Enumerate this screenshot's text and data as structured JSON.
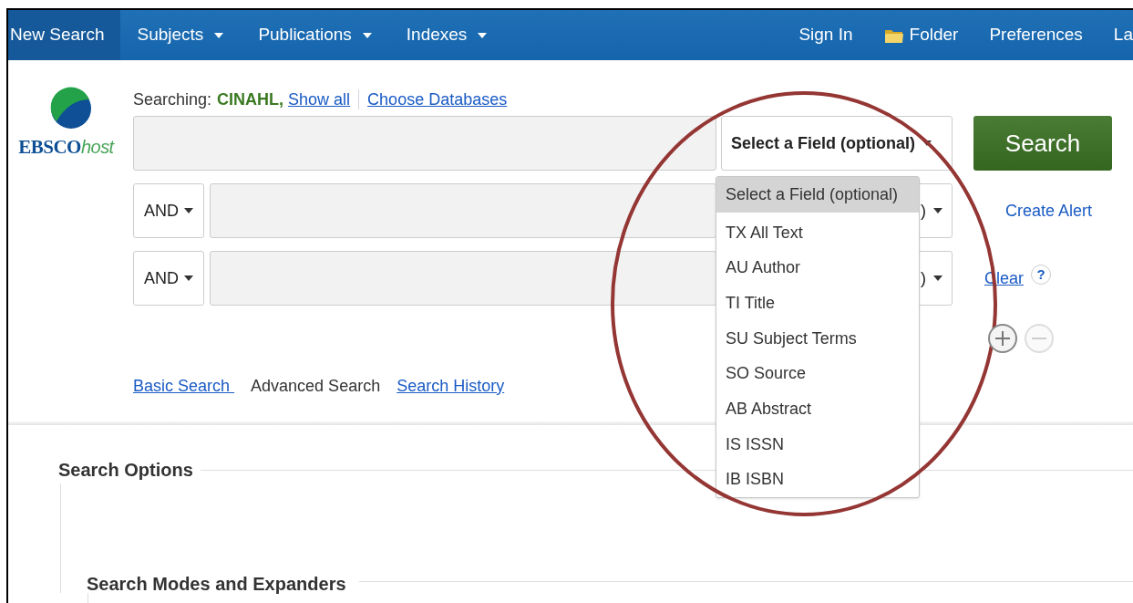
{
  "nav": {
    "left": [
      {
        "label": "New Search",
        "selected": true,
        "caret": false
      },
      {
        "label": "Subjects",
        "selected": false,
        "caret": true
      },
      {
        "label": "Publications",
        "selected": false,
        "caret": true
      },
      {
        "label": "Indexes",
        "selected": false,
        "caret": true
      }
    ],
    "right": [
      {
        "label": "Sign In",
        "kind": "link"
      },
      {
        "label": "Folder",
        "kind": "folder"
      },
      {
        "label": "Preferences",
        "kind": "link"
      },
      {
        "label": "La",
        "kind": "link"
      }
    ]
  },
  "logo": {
    "text_bold": "EBSCO",
    "text_italic": "host"
  },
  "searching": {
    "label": "Searching:",
    "database": "CINAHL,",
    "show_all": "Show all",
    "choose": "Choose Databases"
  },
  "rows": [
    {
      "operator": null,
      "field": "Select a Field (optional)"
    },
    {
      "operator": "AND",
      "field": ")"
    },
    {
      "operator": "AND",
      "field": ")"
    }
  ],
  "search_button": "Search",
  "create_alert": "Create Alert",
  "clear": "Clear",
  "help": "?",
  "modes": [
    {
      "label": "Basic Search ",
      "selected": false
    },
    {
      "label": "Advanced Search",
      "selected": true
    },
    {
      "label": "Search History",
      "selected": false
    }
  ],
  "field_dropdown": [
    {
      "label": "Select a Field (optional)",
      "selected": true
    },
    {
      "label": "TX All Text",
      "selected": false
    },
    {
      "label": "AU Author",
      "selected": false
    },
    {
      "label": "TI Title",
      "selected": false
    },
    {
      "label": "SU Subject Terms",
      "selected": false
    },
    {
      "label": "SO Source",
      "selected": false
    },
    {
      "label": "AB Abstract",
      "selected": false
    },
    {
      "label": "IS ISSN",
      "selected": false
    },
    {
      "label": "IB ISBN",
      "selected": false
    }
  ],
  "search_options": {
    "title": "Search Options",
    "subsection": "Search Modes and Expanders"
  }
}
